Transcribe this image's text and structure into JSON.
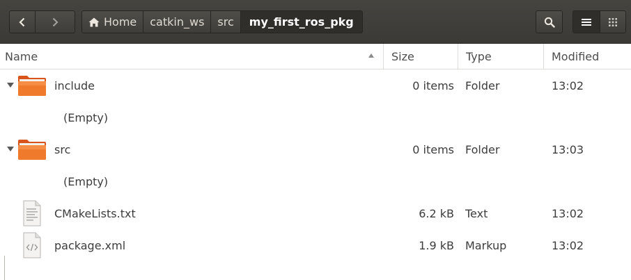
{
  "nav": {
    "back_icon": "chevron-left-icon",
    "forward_icon": "chevron-right-icon",
    "forward_enabled": false
  },
  "pathbar": {
    "home_icon": "home-icon",
    "items": [
      "Home",
      "catkin_ws",
      "src",
      "my_first_ros_pkg"
    ],
    "current_index": 3
  },
  "toolbar": {
    "search_icon": "search-icon",
    "list_view_icon": "list-view-icon",
    "grid_view_icon": "grid-view-icon",
    "active_view": "list"
  },
  "columns": {
    "name": "Name",
    "size": "Size",
    "type": "Type",
    "modified": "Modified",
    "sort_column": "name",
    "sort_icon": "sort-ascending-icon"
  },
  "files": [
    {
      "name": "include",
      "size": "0 items",
      "type": "Folder",
      "modified": "13:02",
      "kind": "folder",
      "expanded": true,
      "empty_label": "(Empty)"
    },
    {
      "name": "src",
      "size": "0 items",
      "type": "Folder",
      "modified": "13:03",
      "kind": "folder",
      "expanded": true,
      "empty_label": "(Empty)"
    },
    {
      "name": "CMakeLists.txt",
      "size": "6.2 kB",
      "type": "Text",
      "modified": "13:02",
      "kind": "text"
    },
    {
      "name": "package.xml",
      "size": "1.9 kB",
      "type": "Markup",
      "modified": "13:02",
      "kind": "markup"
    }
  ],
  "colors": {
    "headerbar": "#3c3b37",
    "folder_orange": "#e9611f",
    "folder_light": "#f6a05c",
    "text": "#3c3c3c"
  }
}
